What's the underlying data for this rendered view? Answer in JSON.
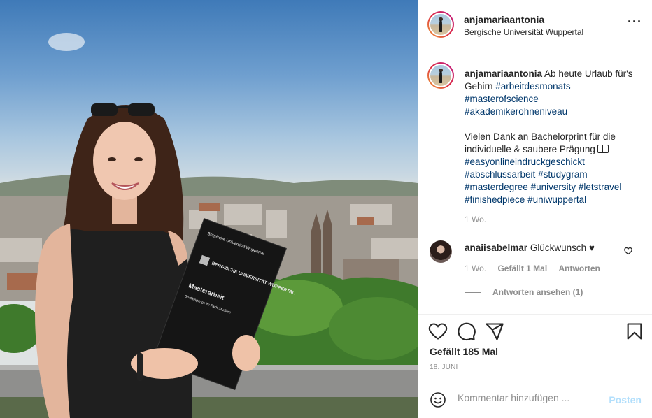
{
  "post": {
    "username": "anjamariaantonia",
    "location": "Bergische Universität Wuppertal",
    "more_icon": "more-horizontal-icon"
  },
  "photo": {
    "folder_line1": "Bergische Universität Wuppertal",
    "folder_logo": "BERGISCHE UNIVERSITÄT WUPPERTAL",
    "folder_title": "Masterarbeit",
    "folder_subtitle": "Studiengänge im Fach Studium"
  },
  "caption": {
    "username": "anjamariaantonia",
    "text1": " Ab heute Urlaub für's Gehirn ",
    "tag1": "#arbeitdesmonats",
    "tag2": "#masterofscience",
    "tag3": "#akademikerohneniveau",
    "text2": "Vielen Dank an Bachelorprint für die individuelle & saubere Prägung",
    "tag4": "#easyonlineindruckgeschickt",
    "tag5": "#abschlussarbeit",
    "tag6": "#studygram",
    "tag7": "#masterdegree",
    "tag8": "#university",
    "tag9": "#letstravel",
    "tag10": "#finishedpiece",
    "tag11": "#uniwuppertal",
    "time": "1 Wo."
  },
  "comment": {
    "username": "anaiisabelmar",
    "text": "Glückwunsch ♥",
    "time": "1 Wo.",
    "likes": "Gefällt 1 Mal",
    "reply": "Antworten",
    "view_replies": "Antworten ansehen (1)"
  },
  "actions": {
    "likes": "Gefällt 185 Mal",
    "date": "18. JUNI",
    "icons": [
      "heart-icon",
      "comment-icon",
      "share-icon",
      "bookmark-icon"
    ]
  },
  "add_comment": {
    "placeholder": "Kommentar hinzufügen ...",
    "post_label": "Posten",
    "emoji_icon": "smiley-icon"
  },
  "colors": {
    "link": "#00376b",
    "muted": "#8e8e8e",
    "post_disabled": "#b2dffc"
  }
}
